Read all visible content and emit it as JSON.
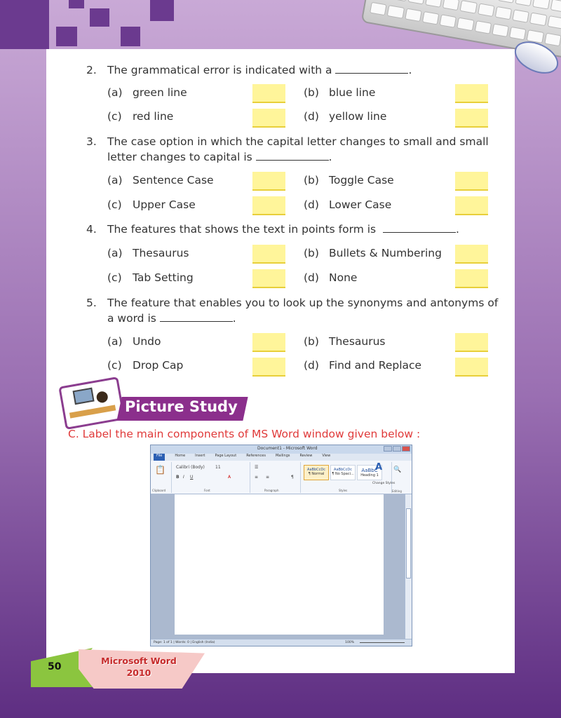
{
  "questions": [
    {
      "number": "2.",
      "text_parts": [
        "The grammatical error is indicated with a",
        "."
      ],
      "options": [
        {
          "letter": "(a)",
          "text": "green line"
        },
        {
          "letter": "(b)",
          "text": "blue line"
        },
        {
          "letter": "(c)",
          "text": "red line"
        },
        {
          "letter": "(d)",
          "text": "yellow line"
        }
      ]
    },
    {
      "number": "3.",
      "text_line1": "The case option in which the capital letter changes to small and small",
      "text_line2_parts": [
        "letter changes to capital is",
        "."
      ],
      "options": [
        {
          "letter": "(a)",
          "text": "Sentence Case"
        },
        {
          "letter": "(b)",
          "text": "Toggle Case"
        },
        {
          "letter": "(c)",
          "text": "Upper Case"
        },
        {
          "letter": "(d)",
          "text": "Lower Case"
        }
      ]
    },
    {
      "number": "4.",
      "text_parts": [
        "The features that shows the text in points form is",
        "."
      ],
      "options": [
        {
          "letter": "(a)",
          "text": "Thesaurus"
        },
        {
          "letter": "(b)",
          "text": "Bullets & Numbering"
        },
        {
          "letter": "(c)",
          "text": "Tab Setting"
        },
        {
          "letter": "(d)",
          "text": "None"
        }
      ]
    },
    {
      "number": "5.",
      "text_line1": "The feature that enables you to look up the synonyms and antonyms of",
      "text_line2_parts": [
        "a word is",
        "."
      ],
      "options": [
        {
          "letter": "(a)",
          "text": "Undo"
        },
        {
          "letter": "(b)",
          "text": "Thesaurus"
        },
        {
          "letter": "(c)",
          "text": "Drop Cap"
        },
        {
          "letter": "(d)",
          "text": "Find and Replace"
        }
      ]
    }
  ],
  "picture_study": {
    "title": "Picture Study",
    "instruction": "C.  Label the main components of MS Word window given below :"
  },
  "word_window": {
    "title": "Document1 - Microsoft Word",
    "tabs": [
      "File",
      "Home",
      "Insert",
      "Page Layout",
      "References",
      "Mailings",
      "Review",
      "View"
    ],
    "font_name": "Calibri (Body)",
    "font_size": "11",
    "styles": [
      "AaBbCcDc",
      "AaBbCcDc",
      "AaBbC"
    ],
    "style_names": [
      "¶ Normal",
      "¶ No Spaci...",
      "Heading 1"
    ],
    "groups": [
      "Clipboard",
      "Font",
      "Paragraph",
      "Styles",
      "Editing"
    ],
    "change_styles": "Change Styles",
    "status": [
      "Page: 1 of 1",
      "Words: 0",
      "English (India)"
    ],
    "zoom": "100%"
  },
  "footer": {
    "page_number": "50",
    "title_line1": "Microsoft Word",
    "title_line2": "2010"
  },
  "colors": {
    "accent_purple": "#6b3a8f",
    "answer_box": "#fff59a",
    "instruction_red": "#e03a3a",
    "banner": "#8b2f8c"
  }
}
